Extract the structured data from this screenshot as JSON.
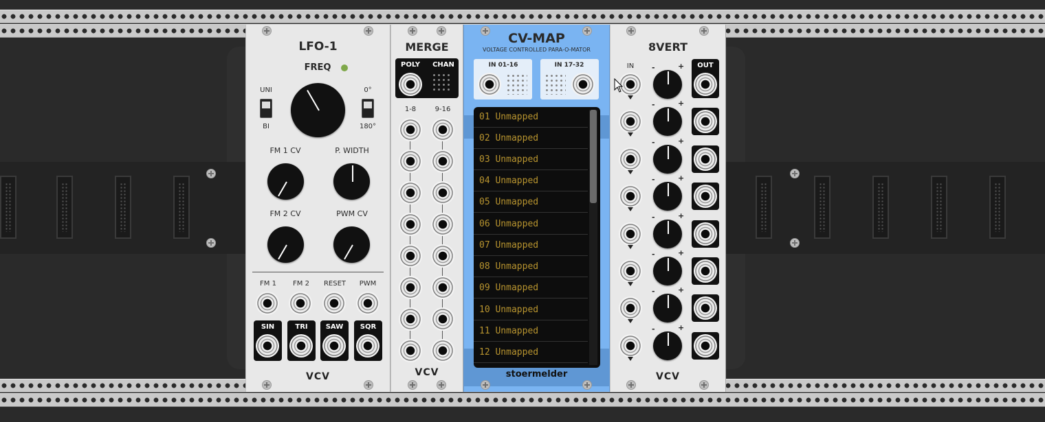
{
  "lfo": {
    "title": "LFO-1",
    "freq": "FREQ",
    "uni": "UNI",
    "bi": "BI",
    "deg0": "0°",
    "deg180": "180°",
    "fm1cv": "FM 1 CV",
    "pwidth": "P. WIDTH",
    "fm2cv": "FM 2 CV",
    "pwmcv": "PWM CV",
    "inputs": [
      "FM 1",
      "FM 2",
      "RESET",
      "PWM"
    ],
    "outputs": [
      "SIN",
      "TRI",
      "SAW",
      "SQR"
    ],
    "brand": "VCV",
    "led_color": "#7fa84a"
  },
  "merge": {
    "title": "MERGE",
    "poly": "POLY",
    "chan": "CHAN",
    "col1": "1-8",
    "col2": "9-16",
    "brand": "VCV"
  },
  "cvmap": {
    "title": "CV-MAP",
    "subtitle": "VOLTAGE CONTROLLED PARA-O-MATOR",
    "in1": "IN 01-16",
    "in2": "IN 17-32",
    "items": [
      "01 Unmapped",
      "02 Unmapped",
      "03 Unmapped",
      "04 Unmapped",
      "05 Unmapped",
      "06 Unmapped",
      "07 Unmapped",
      "08 Unmapped",
      "09 Unmapped",
      "10 Unmapped",
      "11 Unmapped",
      "12 Unmapped"
    ],
    "brand": "stoermelder",
    "panel_color": "#7ab4f2"
  },
  "eightvert": {
    "title": "8VERT",
    "in": "IN",
    "out": "OUT",
    "minus": "-",
    "plus": "+",
    "brand": "VCV"
  }
}
